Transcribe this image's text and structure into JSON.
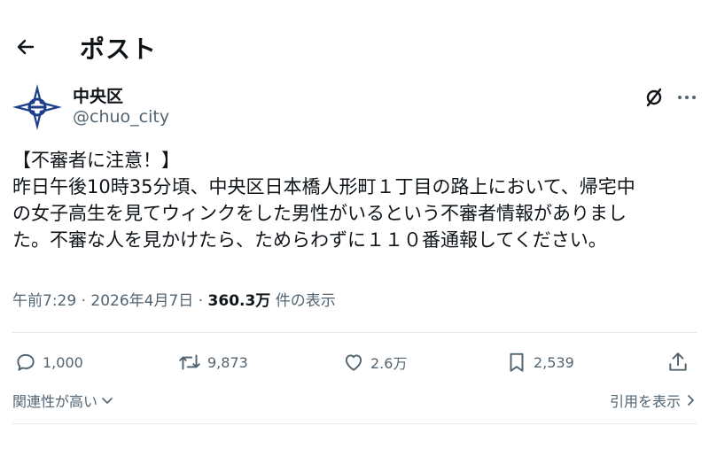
{
  "header": {
    "title": "ポスト",
    "back_icon": "arrow-left-icon"
  },
  "author": {
    "name": "中央区",
    "handle": "@chuo_city",
    "avatar_icon": "chuo-city-emblem",
    "grok_icon": "grok-icon",
    "more_icon": "more-dots-icon"
  },
  "tweet": {
    "lines": [
      "【不審者に注意！】",
      "昨日午後10時35分頃、中央区日本橋人形町１丁目の路上において、帰宅中",
      "の女子高生を見てウィンクをした男性がいるという不審者情報がありまし",
      "た。不審な人を見かけたら、ためらわずに１１０番通報してください。"
    ]
  },
  "meta": {
    "time": "午前7:29",
    "sep1": " · ",
    "date": "2026年4月7日",
    "sep2": " · ",
    "views": "360.3万",
    "views_suffix": " 件の表示"
  },
  "actions": {
    "reply": {
      "icon": "reply-icon",
      "count": "1,000"
    },
    "repost": {
      "icon": "repost-icon",
      "count": "9,873"
    },
    "like": {
      "icon": "heart-icon",
      "count": "2.6万"
    },
    "bookmark": {
      "icon": "bookmark-icon",
      "count": "2,539"
    },
    "share": {
      "icon": "share-icon"
    }
  },
  "relevance": {
    "sort_label": "関連性が高い",
    "quotes_label": "引用を表示"
  },
  "colors": {
    "text": "#0f1419",
    "secondary": "#536471",
    "emblem_blue": "#1d3e8a",
    "divider": "#e6e8ea"
  }
}
